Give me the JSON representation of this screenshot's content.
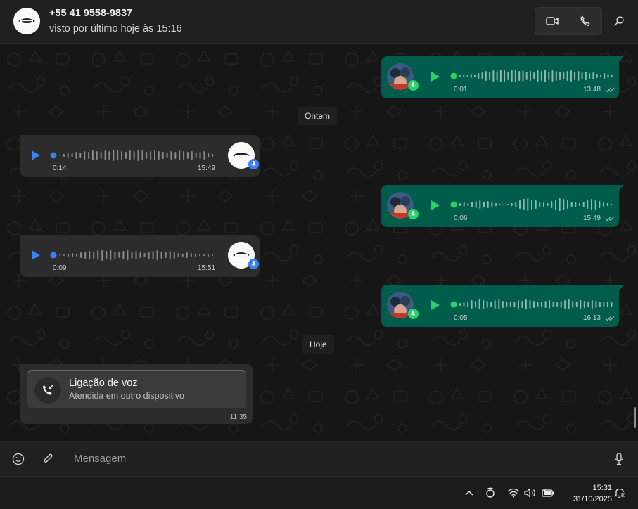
{
  "header": {
    "contact_name": "+55 41 9558-9837",
    "last_seen": "visto por último hoje às 15:16"
  },
  "chat": {
    "day_labels": {
      "yesterday": "Ontem",
      "today": "Hoje"
    },
    "messages": [
      {
        "direction": "outgoing",
        "type": "voice",
        "duration": "0:01",
        "time": "13:48",
        "status": "read"
      },
      {
        "direction": "incoming",
        "type": "voice",
        "duration": "0:14",
        "time": "15:49"
      },
      {
        "direction": "outgoing",
        "type": "voice",
        "duration": "0:06",
        "time": "15:49",
        "status": "read"
      },
      {
        "direction": "incoming",
        "type": "voice",
        "duration": "0:09",
        "time": "15:51"
      },
      {
        "direction": "outgoing",
        "type": "voice",
        "duration": "0:05",
        "time": "16:13",
        "status": "read"
      },
      {
        "direction": "incoming",
        "type": "call",
        "title": "Ligação de voz",
        "subtitle": "Atendida em outro dispositivo",
        "time": "11:35"
      }
    ]
  },
  "composer": {
    "placeholder": "Mensagem"
  },
  "taskbar": {
    "time": "15:31",
    "date": "31/10/2025"
  },
  "colors": {
    "outgoing_bubble": "#005c4b",
    "incoming_bubble": "#2c2c2c",
    "play_outgoing": "#25d366",
    "play_incoming": "#3b82f6",
    "header": "#202020"
  },
  "icons": {
    "video": "video-call-icon",
    "voice": "voice-call-icon",
    "search": "search-icon",
    "emoji": "emoji-icon",
    "attach": "paperclip-icon",
    "mic": "microphone-icon"
  }
}
